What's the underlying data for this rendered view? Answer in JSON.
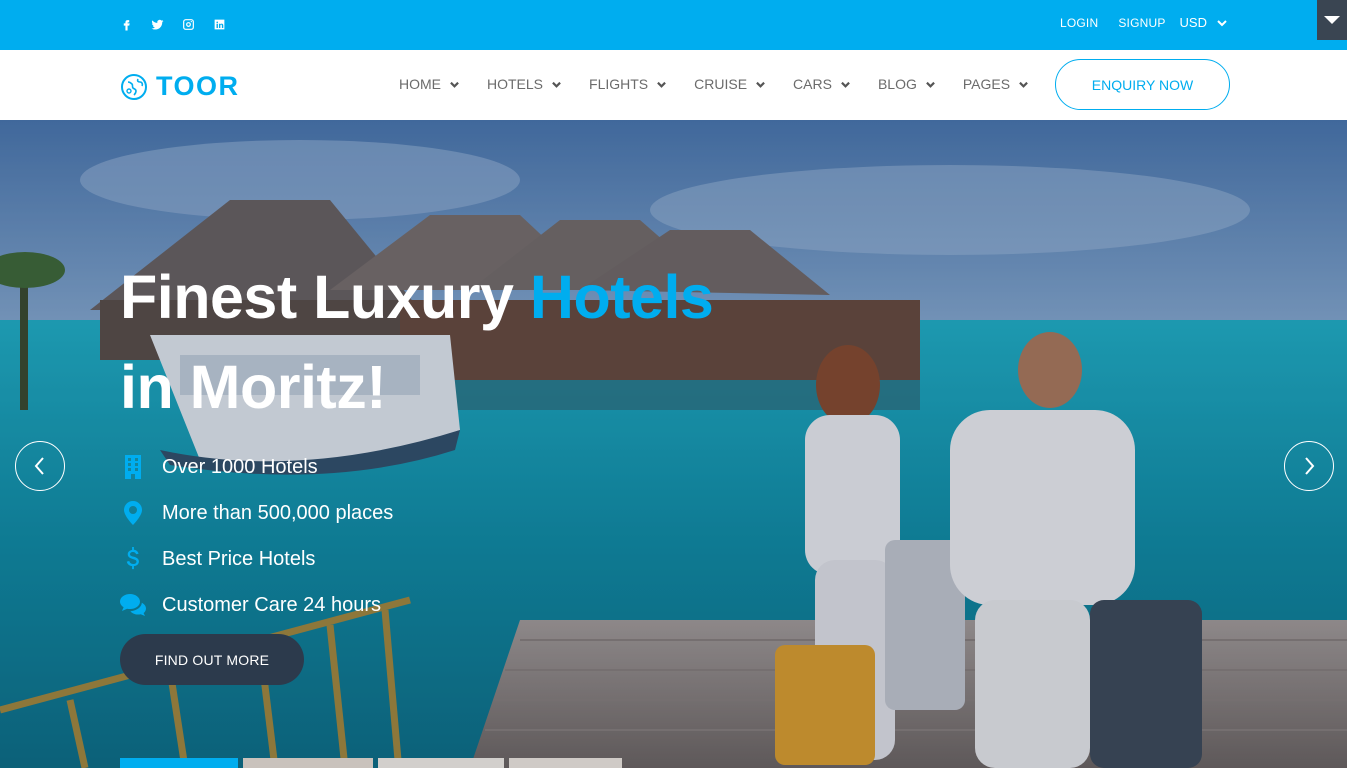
{
  "topbar": {
    "social": [
      {
        "icon": "facebook-icon"
      },
      {
        "icon": "twitter-icon"
      },
      {
        "icon": "instagram-icon"
      },
      {
        "icon": "linkedin-icon"
      }
    ],
    "login_label": "LOGIN",
    "signup_label": "SIGNUP",
    "currency": "USD"
  },
  "brand": {
    "name": "TOOR",
    "color": "#00adef"
  },
  "nav": {
    "items": [
      {
        "label": "HOME"
      },
      {
        "label": "HOTELS"
      },
      {
        "label": "FLIGHTS"
      },
      {
        "label": "CRUISE"
      },
      {
        "label": "CARS"
      },
      {
        "label": "BLOG"
      },
      {
        "label": "PAGES"
      }
    ],
    "enquiry_label": "ENQUIRY NOW"
  },
  "hero": {
    "title_part1": "Finest Luxury ",
    "title_accent": "Hotels",
    "title_line2": "in Moritz!",
    "features": [
      {
        "icon": "building-icon",
        "text": "Over 1000 Hotels"
      },
      {
        "icon": "map-pin-icon",
        "text": "More than 500,000 places"
      },
      {
        "icon": "dollar-icon",
        "text": "Best Price Hotels"
      },
      {
        "icon": "chat-bubbles-icon",
        "text": "Customer Care 24 hours"
      }
    ],
    "cta_label": "FIND OUT MORE"
  },
  "colors": {
    "accent": "#00adef",
    "dark": "#2c3a4c"
  }
}
